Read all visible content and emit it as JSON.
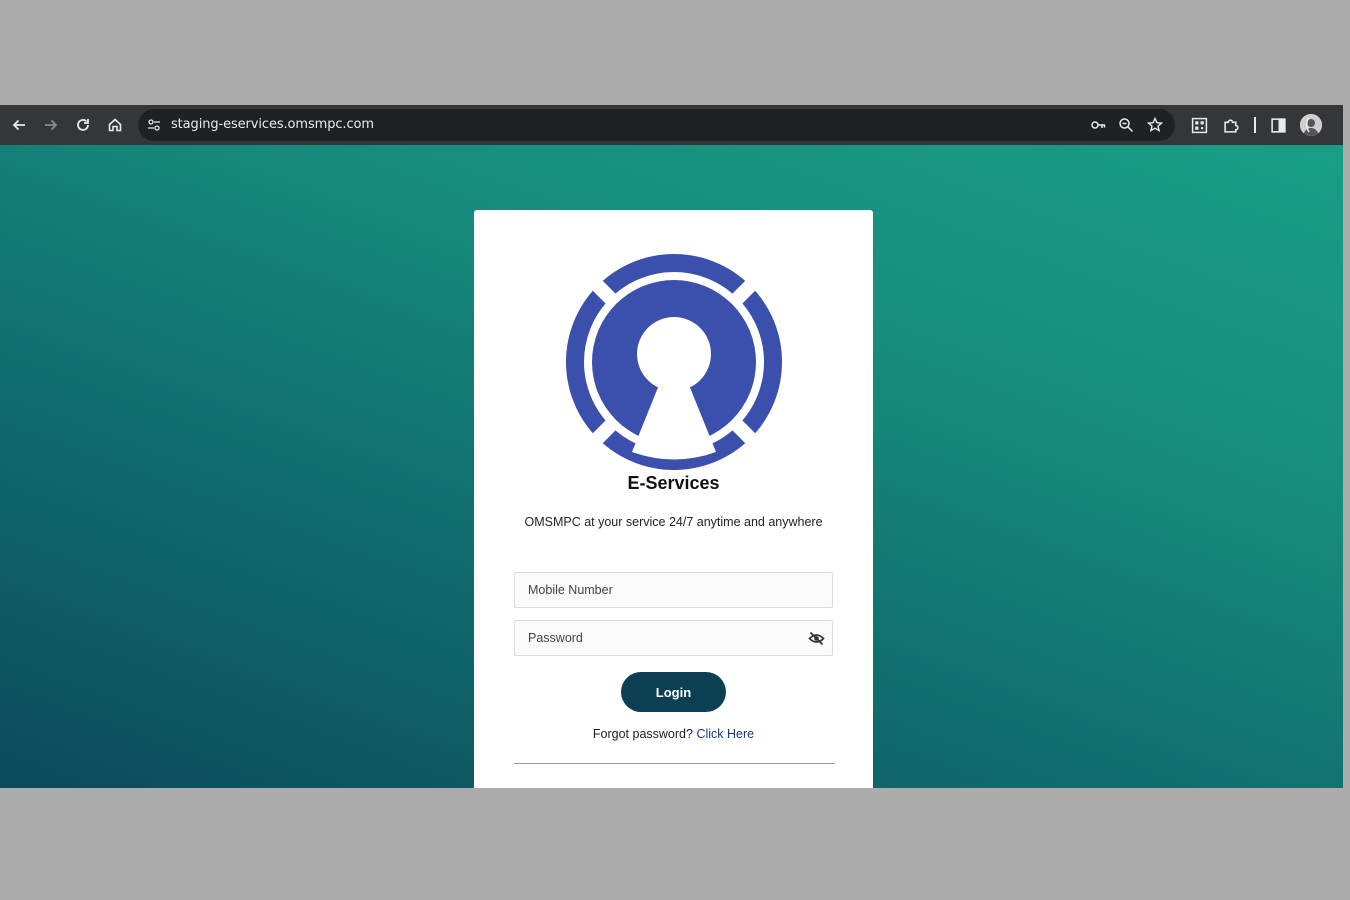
{
  "browser": {
    "url": "staging-eservices.omsmpc.com",
    "icons": [
      "back-icon",
      "forward-icon",
      "reload-icon",
      "home-icon",
      "site-info-icon",
      "password-key-icon",
      "zoom-icon",
      "bookmark-star-icon",
      "qr-code-icon",
      "extensions-icon",
      "side-panel-icon",
      "profile-avatar",
      "menu-icon"
    ]
  },
  "login": {
    "title": "E-Services",
    "tagline": "OMSMPC at your service 24/7 anytime and anywhere",
    "mobile_placeholder": "Mobile Number",
    "password_placeholder": "Password",
    "login_label": "Login",
    "forgot_text": "Forgot password?",
    "forgot_link": "Click Here"
  },
  "colors": {
    "logo_blue": "#3b4fac",
    "button": "#0d3f52",
    "gradient_start": "#0c4a5c",
    "gradient_end": "#199e85",
    "link": "#1b3a7a"
  }
}
